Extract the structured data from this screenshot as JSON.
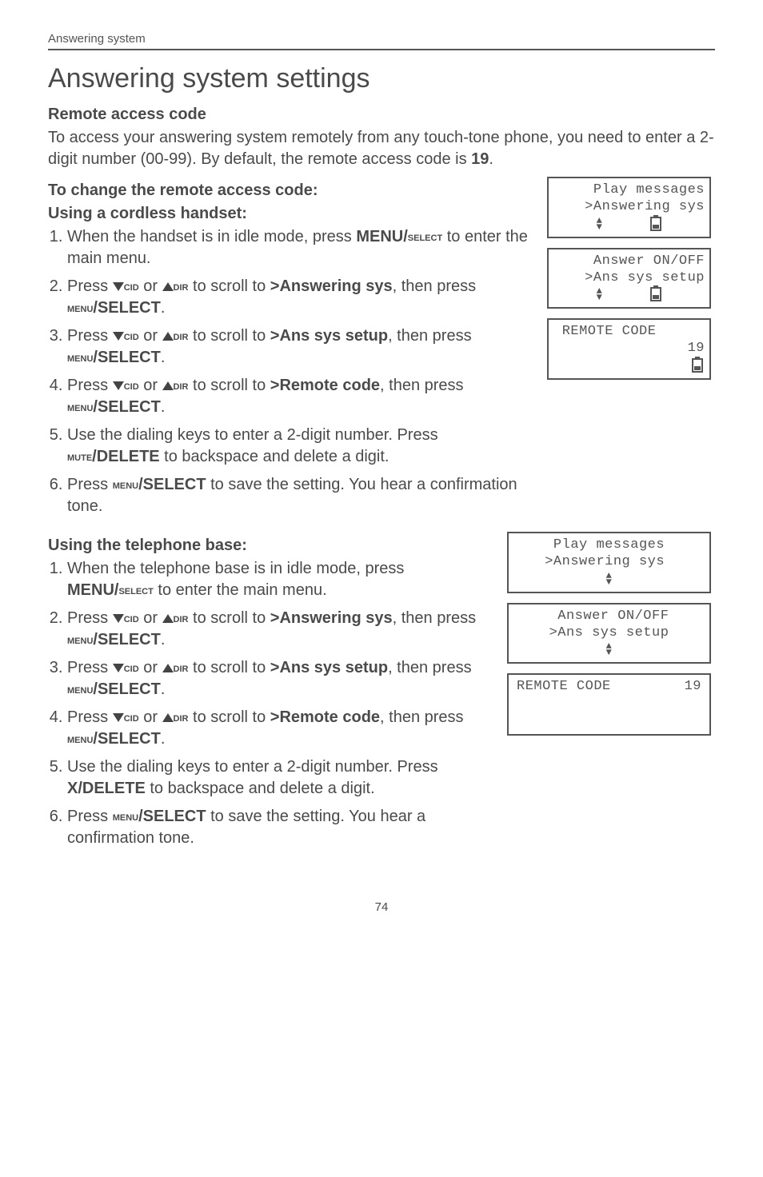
{
  "header": {
    "topline": "Answering system"
  },
  "title": "Answering system settings",
  "section1": {
    "heading": "Remote access code",
    "intro_a": "To access your answering system remotely from any touch-tone phone, you need to enter a 2-digit number (00-99). By default, the remote access code is ",
    "intro_b": "19",
    "intro_c": "."
  },
  "handset": {
    "lead1": "To change the remote access code:",
    "lead2": "Using a cordless handset:",
    "step1a": "When the handset is in idle mode, press ",
    "step1b": "MENU/",
    "step1c": "select",
    "step1d": " to enter the main menu.",
    "step2a": "Press ",
    "step2b": "cid",
    "step2c": " or ",
    "step2d": "dir",
    "step2e": " to scroll to ",
    "step2f": ">Answering sys",
    "step2g": ", then press ",
    "step2h": "menu",
    "step2i": "/SELECT",
    "step2j": ".",
    "step3f": ">Ans sys setup",
    "step4f": ">Remote code",
    "step4g": ", then press ",
    "step5a": "Use the dialing keys to enter a 2-digit number. Press ",
    "step5b": "mute",
    "step5c": "/DELETE",
    "step5d": " to backspace and delete a digit.",
    "step6a": "Press ",
    "step6d": " to save the setting. You hear a confirmation tone."
  },
  "base": {
    "lead": "Using the telephone base:",
    "step1a": "When the telephone base is in idle mode, press ",
    "step5b": "X/DELETE"
  },
  "lcd1": {
    "l1": " Play messages",
    "l2": ">Answering sys"
  },
  "lcd2": {
    "l1": " Answer ON/OFF",
    "l2": ">Ans sys setup"
  },
  "lcd3": {
    "l1": " REMOTE CODE  ",
    "l2": "19"
  },
  "lcd4": {
    "l1": " Play messages ",
    "l2": ">Answering sys "
  },
  "lcd5": {
    "l1": " Answer ON/OFF",
    "l2": ">Ans sys setup"
  },
  "lcd6": {
    "l1": "REMOTE CODE",
    "l2": "19"
  },
  "pagenum": "74"
}
